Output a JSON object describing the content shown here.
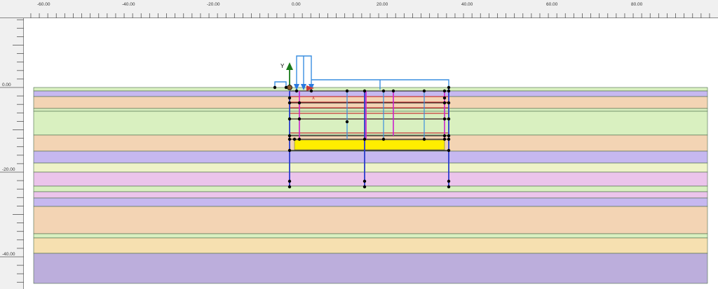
{
  "top_ruler": {
    "labels": [
      "-60.00",
      "-40.00",
      "-20.00",
      "0.00",
      "20.00",
      "40.00",
      "60.00",
      "80.00"
    ],
    "values": [
      -60,
      -40,
      -20,
      0,
      20,
      40,
      60,
      80
    ]
  },
  "left_ruler": {
    "labels": [
      "0.00",
      "-20.00",
      "-40.00"
    ],
    "values": [
      0,
      -20,
      -40
    ]
  },
  "axes": {
    "y_label": "Y",
    "x_label": "x"
  },
  "soil_layers": [
    {
      "color": "#d9f0c0"
    },
    {
      "color": "#c6b8f0"
    },
    {
      "color": "#f3d4b4"
    },
    {
      "color": "#d9f0c0"
    },
    {
      "color": "#f3d4b4"
    },
    {
      "color": "#c6b8f0"
    },
    {
      "color": "#eef3c8"
    },
    {
      "color": "#ebc4eb"
    },
    {
      "color": "#d9f0c0"
    },
    {
      "color": "#ebc4eb"
    },
    {
      "color": "#c6b8f0"
    },
    {
      "color": "#f3d4b4"
    },
    {
      "color": "#d9f0c0"
    },
    {
      "color": "#f6e0b0"
    },
    {
      "color": "#bcaedc"
    }
  ],
  "colors": {
    "structure_blue": "#2a3ccc",
    "anchor_purple": "#cc22cc",
    "strut_red": "#c83838",
    "load_blue": "#3a8fe0",
    "excavation_yellow": "#ffee00",
    "axis_green": "#1a7a1a",
    "node_black": "#000000"
  },
  "icons": [
    "y-axis-arrow-icon",
    "x-axis-arrow-icon",
    "load-arrow-icon"
  ]
}
